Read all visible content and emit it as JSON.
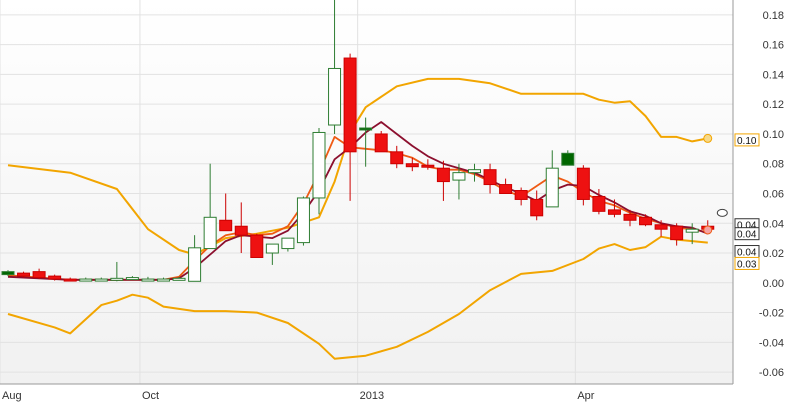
{
  "chart_data": {
    "type": "candlestick",
    "x_tick_labels": [
      "Aug",
      "Oct",
      "2013",
      "Apr"
    ],
    "y_ticks": [
      0.18,
      0.16,
      0.14,
      0.12,
      0.1,
      0.08,
      0.06,
      0.04,
      0.02,
      0.0,
      -0.02,
      -0.04,
      -0.06
    ],
    "y_tick_labels": [
      "0.18",
      "0.16",
      "0.14",
      "0.12",
      "0.10",
      "0.08",
      "0.06",
      "0.04",
      "0.02",
      "0.00",
      "-0.02",
      "-0.04",
      "-0.06"
    ],
    "ylim": [
      -0.068,
      0.19
    ],
    "x_count": 50,
    "x_tick_positions": [
      0,
      9,
      23,
      37
    ],
    "candles": [
      {
        "o": 0.0055,
        "h": 0.0085,
        "l": 0.0045,
        "c": 0.0075,
        "up": true,
        "color": "#006600"
      },
      {
        "o": 0.0065,
        "h": 0.0075,
        "l": 0.0035,
        "c": 0.0045,
        "up": false,
        "color": "#ee1111"
      },
      {
        "o": 0.0075,
        "h": 0.0095,
        "l": 0.0025,
        "c": 0.0035,
        "up": false,
        "color": "#ee1111"
      },
      {
        "o": 0.0045,
        "h": 0.0055,
        "l": 0.0015,
        "c": 0.0025,
        "up": false,
        "color": "#ee1111"
      },
      {
        "o": 0.0025,
        "h": 0.0035,
        "l": 0.0015,
        "c": 0.0015,
        "up": false,
        "color": "#ee1111"
      },
      {
        "o": 0.0015,
        "h": 0.0035,
        "l": 0.001,
        "c": 0.0025,
        "up": true,
        "color": "#009900"
      },
      {
        "o": 0.0025,
        "h": 0.0035,
        "l": 0.0015,
        "c": 0.0025,
        "up": true,
        "color": "#009900"
      },
      {
        "o": 0.002,
        "h": 0.014,
        "l": 0.001,
        "c": 0.003,
        "up": true,
        "color": "#009900"
      },
      {
        "o": 0.0025,
        "h": 0.0045,
        "l": 0.002,
        "c": 0.0035,
        "up": true,
        "color": "#009900"
      },
      {
        "o": 0.002,
        "h": 0.004,
        "l": 0.0015,
        "c": 0.0025,
        "up": true,
        "color": "#009900"
      },
      {
        "o": 0.0025,
        "h": 0.0035,
        "l": 0.0015,
        "c": 0.0025,
        "up": true,
        "color": "#009900"
      },
      {
        "o": 0.0025,
        "h": 0.004,
        "l": 0.0015,
        "c": 0.003,
        "up": true,
        "color": "#009900"
      },
      {
        "o": 0.001,
        "h": 0.032,
        "l": 0.001,
        "c": 0.0235,
        "up": true,
        "color": "#009900"
      },
      {
        "o": 0.023,
        "h": 0.08,
        "l": 0.023,
        "c": 0.044,
        "up": true,
        "color": "#009900"
      },
      {
        "o": 0.042,
        "h": 0.06,
        "l": 0.036,
        "c": 0.035,
        "up": false,
        "color": "#ee1111"
      },
      {
        "o": 0.038,
        "h": 0.054,
        "l": 0.02,
        "c": 0.032,
        "up": false,
        "color": "#ee1111"
      },
      {
        "o": 0.032,
        "h": 0.033,
        "l": 0.017,
        "c": 0.017,
        "up": false,
        "color": "#ee1111"
      },
      {
        "o": 0.02,
        "h": 0.025,
        "l": 0.012,
        "c": 0.026,
        "up": true,
        "color": "#009900"
      },
      {
        "o": 0.023,
        "h": 0.03,
        "l": 0.021,
        "c": 0.03,
        "up": true,
        "color": "#009900"
      },
      {
        "o": 0.027,
        "h": 0.058,
        "l": 0.025,
        "c": 0.057,
        "up": true,
        "color": "#009900"
      },
      {
        "o": 0.057,
        "h": 0.104,
        "l": 0.046,
        "c": 0.101,
        "up": true,
        "color": "#009900"
      },
      {
        "o": 0.106,
        "h": 0.19,
        "l": 0.1,
        "c": 0.144,
        "up": true,
        "color": "#009900"
      },
      {
        "o": 0.151,
        "h": 0.154,
        "l": 0.055,
        "c": 0.088,
        "up": false,
        "color": "#ee1111"
      },
      {
        "o": 0.103,
        "h": 0.111,
        "l": 0.078,
        "c": 0.104,
        "up": true,
        "color": "#006600"
      },
      {
        "o": 0.1,
        "h": 0.102,
        "l": 0.089,
        "c": 0.088,
        "up": false,
        "color": "#ee1111"
      },
      {
        "o": 0.088,
        "h": 0.092,
        "l": 0.077,
        "c": 0.08,
        "up": false,
        "color": "#ee1111"
      },
      {
        "o": 0.08,
        "h": 0.084,
        "l": 0.075,
        "c": 0.078,
        "up": false,
        "color": "#ee1111"
      },
      {
        "o": 0.079,
        "h": 0.083,
        "l": 0.076,
        "c": 0.078,
        "up": false,
        "color": "#ee1111"
      },
      {
        "o": 0.077,
        "h": 0.082,
        "l": 0.055,
        "c": 0.068,
        "up": false,
        "color": "#ee1111"
      },
      {
        "o": 0.069,
        "h": 0.08,
        "l": 0.056,
        "c": 0.074,
        "up": true,
        "color": "#009900"
      },
      {
        "o": 0.074,
        "h": 0.08,
        "l": 0.068,
        "c": 0.076,
        "up": true,
        "color": "#009900"
      },
      {
        "o": 0.076,
        "h": 0.08,
        "l": 0.06,
        "c": 0.066,
        "up": false,
        "color": "#ee1111"
      },
      {
        "o": 0.066,
        "h": 0.07,
        "l": 0.06,
        "c": 0.06,
        "up": false,
        "color": "#ee1111"
      },
      {
        "o": 0.062,
        "h": 0.064,
        "l": 0.052,
        "c": 0.056,
        "up": false,
        "color": "#ee1111"
      },
      {
        "o": 0.056,
        "h": 0.062,
        "l": 0.042,
        "c": 0.045,
        "up": false,
        "color": "#ee1111"
      },
      {
        "o": 0.051,
        "h": 0.089,
        "l": 0.051,
        "c": 0.077,
        "up": true,
        "color": "#009900"
      },
      {
        "o": 0.079,
        "h": 0.089,
        "l": 0.079,
        "c": 0.087,
        "up": true,
        "color": "#006600"
      },
      {
        "o": 0.077,
        "h": 0.079,
        "l": 0.052,
        "c": 0.056,
        "up": false,
        "color": "#ee1111"
      },
      {
        "o": 0.058,
        "h": 0.063,
        "l": 0.046,
        "c": 0.048,
        "up": false,
        "color": "#ee1111"
      },
      {
        "o": 0.049,
        "h": 0.056,
        "l": 0.044,
        "c": 0.046,
        "up": false,
        "color": "#ee1111"
      },
      {
        "o": 0.046,
        "h": 0.049,
        "l": 0.038,
        "c": 0.042,
        "up": false,
        "color": "#ee1111"
      },
      {
        "o": 0.044,
        "h": 0.046,
        "l": 0.038,
        "c": 0.039,
        "up": false,
        "color": "#ee1111"
      },
      {
        "o": 0.039,
        "h": 0.042,
        "l": 0.031,
        "c": 0.036,
        "up": false,
        "color": "#ee1111"
      },
      {
        "o": 0.038,
        "h": 0.04,
        "l": 0.025,
        "c": 0.029,
        "up": false,
        "color": "#ee1111"
      },
      {
        "o": 0.034,
        "h": 0.04,
        "l": 0.026,
        "c": 0.036,
        "up": true,
        "color": "#009900"
      },
      {
        "o": 0.038,
        "h": 0.042,
        "l": 0.033,
        "c": 0.036,
        "up": false,
        "color": "#ee1111"
      }
    ],
    "bollinger_upper": [
      [
        0,
        0.079
      ],
      [
        4,
        0.074
      ],
      [
        7,
        0.063
      ],
      [
        9,
        0.036
      ],
      [
        11,
        0.022
      ],
      [
        12,
        0.019
      ],
      [
        14,
        0.03
      ],
      [
        16,
        0.033
      ],
      [
        18,
        0.037
      ],
      [
        20,
        0.044
      ],
      [
        21,
        0.068
      ],
      [
        22,
        0.101
      ],
      [
        23,
        0.118
      ],
      [
        25,
        0.132
      ],
      [
        27,
        0.137
      ],
      [
        29,
        0.137
      ],
      [
        31,
        0.134
      ],
      [
        33,
        0.127
      ],
      [
        35,
        0.127
      ],
      [
        37,
        0.127
      ],
      [
        38,
        0.123
      ],
      [
        39,
        0.121
      ],
      [
        40,
        0.122
      ],
      [
        41,
        0.112
      ],
      [
        42,
        0.098
      ],
      [
        43,
        0.098
      ],
      [
        44,
        0.095
      ],
      [
        45,
        0.097
      ]
    ],
    "bollinger_lower": [
      [
        0,
        -0.021
      ],
      [
        3,
        -0.03
      ],
      [
        4,
        -0.034
      ],
      [
        6,
        -0.015
      ],
      [
        7,
        -0.012
      ],
      [
        8,
        -0.008
      ],
      [
        9,
        -0.01
      ],
      [
        10,
        -0.016
      ],
      [
        12,
        -0.019
      ],
      [
        14,
        -0.019
      ],
      [
        16,
        -0.02
      ],
      [
        18,
        -0.027
      ],
      [
        20,
        -0.041
      ],
      [
        21,
        -0.051
      ],
      [
        22,
        -0.05
      ],
      [
        23,
        -0.049
      ],
      [
        25,
        -0.043
      ],
      [
        27,
        -0.033
      ],
      [
        29,
        -0.021
      ],
      [
        31,
        -0.005
      ],
      [
        33,
        0.006
      ],
      [
        35,
        0.008
      ],
      [
        37,
        0.016
      ],
      [
        38,
        0.023
      ],
      [
        39,
        0.026
      ],
      [
        40,
        0.022
      ],
      [
        41,
        0.024
      ],
      [
        42,
        0.031
      ],
      [
        43,
        0.029
      ],
      [
        44,
        0.028
      ],
      [
        45,
        0.027
      ]
    ],
    "ma_orange": [
      [
        0,
        0.005
      ],
      [
        4,
        0.002
      ],
      [
        8,
        0.002
      ],
      [
        10,
        0.002
      ],
      [
        11,
        0.004
      ],
      [
        12,
        0.015
      ],
      [
        13,
        0.025
      ],
      [
        14,
        0.032
      ],
      [
        15,
        0.034
      ],
      [
        16,
        0.032
      ],
      [
        17,
        0.033
      ],
      [
        18,
        0.038
      ],
      [
        19,
        0.053
      ],
      [
        20,
        0.074
      ],
      [
        21,
        0.098
      ],
      [
        22,
        0.091
      ],
      [
        23,
        0.09
      ],
      [
        24,
        0.089
      ],
      [
        25,
        0.087
      ],
      [
        26,
        0.084
      ],
      [
        27,
        0.078
      ],
      [
        28,
        0.076
      ],
      [
        29,
        0.076
      ],
      [
        30,
        0.073
      ],
      [
        31,
        0.068
      ],
      [
        32,
        0.062
      ],
      [
        33,
        0.058
      ],
      [
        34,
        0.065
      ],
      [
        35,
        0.072
      ],
      [
        36,
        0.068
      ],
      [
        37,
        0.061
      ],
      [
        38,
        0.055
      ],
      [
        39,
        0.052
      ],
      [
        40,
        0.047
      ],
      [
        41,
        0.043
      ],
      [
        42,
        0.04
      ],
      [
        43,
        0.037
      ],
      [
        44,
        0.036
      ],
      [
        45,
        0.034
      ]
    ],
    "ma_dark": [
      [
        0,
        0.004
      ],
      [
        4,
        0.002
      ],
      [
        8,
        0.002
      ],
      [
        10,
        0.002
      ],
      [
        11,
        0.003
      ],
      [
        12,
        0.01
      ],
      [
        13,
        0.019
      ],
      [
        14,
        0.028
      ],
      [
        15,
        0.032
      ],
      [
        16,
        0.031
      ],
      [
        17,
        0.03
      ],
      [
        18,
        0.035
      ],
      [
        19,
        0.047
      ],
      [
        20,
        0.062
      ],
      [
        21,
        0.083
      ],
      [
        22,
        0.091
      ],
      [
        23,
        0.101
      ],
      [
        24,
        0.108
      ],
      [
        25,
        0.1
      ],
      [
        26,
        0.092
      ],
      [
        27,
        0.085
      ],
      [
        28,
        0.08
      ],
      [
        29,
        0.077
      ],
      [
        30,
        0.074
      ],
      [
        31,
        0.069
      ],
      [
        32,
        0.064
      ],
      [
        33,
        0.06
      ],
      [
        34,
        0.055
      ],
      [
        35,
        0.062
      ],
      [
        36,
        0.066
      ],
      [
        37,
        0.065
      ],
      [
        38,
        0.059
      ],
      [
        39,
        0.054
      ],
      [
        40,
        0.048
      ],
      [
        41,
        0.045
      ],
      [
        42,
        0.04
      ],
      [
        43,
        0.038
      ],
      [
        44,
        0.037
      ],
      [
        45,
        0.033
      ]
    ],
    "right_labels": [
      {
        "text": "0.10",
        "value": 0.096,
        "style": "orange"
      },
      {
        "text": "0.04",
        "value": 0.039,
        "style": "dark"
      },
      {
        "text": "0.04",
        "value": 0.033,
        "style": "dark"
      },
      {
        "text": "0.04",
        "value": 0.021,
        "style": "dark"
      },
      {
        "text": "0.03",
        "value": 0.013,
        "style": "orange"
      }
    ],
    "colors": {
      "bollinger": "#f2a500",
      "ma_orange": "#ef5a14",
      "ma_dark": "#8c0f2e",
      "grid": "#e2e2e2",
      "axis": "#999999",
      "text": "#333333"
    },
    "grid": true
  }
}
